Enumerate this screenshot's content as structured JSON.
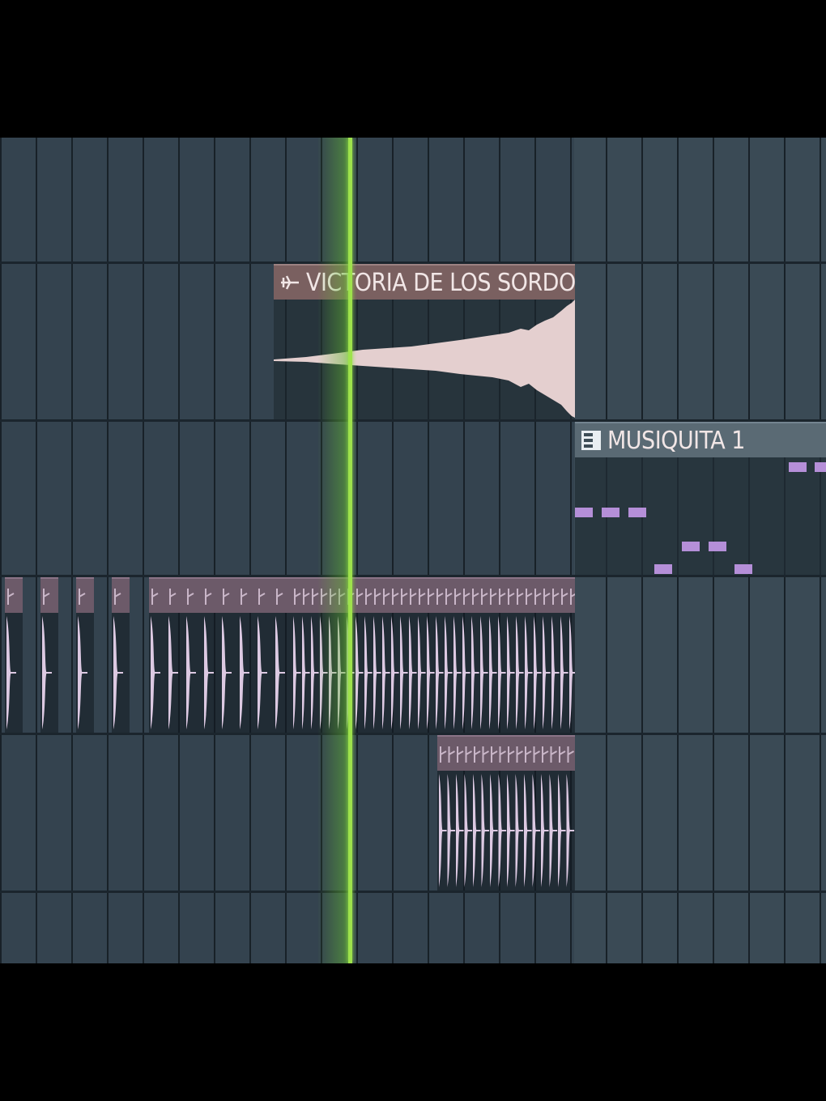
{
  "app": "FL Studio Playlist",
  "clips": {
    "audio": {
      "name": "VICTORIA DE LOS SORDOS",
      "icon": "audio-clip-icon"
    },
    "pattern": {
      "name": "MUSIQUITA 1",
      "icon": "pattern-clip-icon"
    }
  },
  "colors": {
    "background": "#34434f",
    "playhead": "#9ee24c",
    "audio_clip_header": "#7a6060",
    "waveform": "#e4cfcf",
    "pattern_notes": "#b58fd8",
    "rhythm_clip_header": "#6c5a69",
    "rhythm_waveform": "#dcc9e2"
  }
}
